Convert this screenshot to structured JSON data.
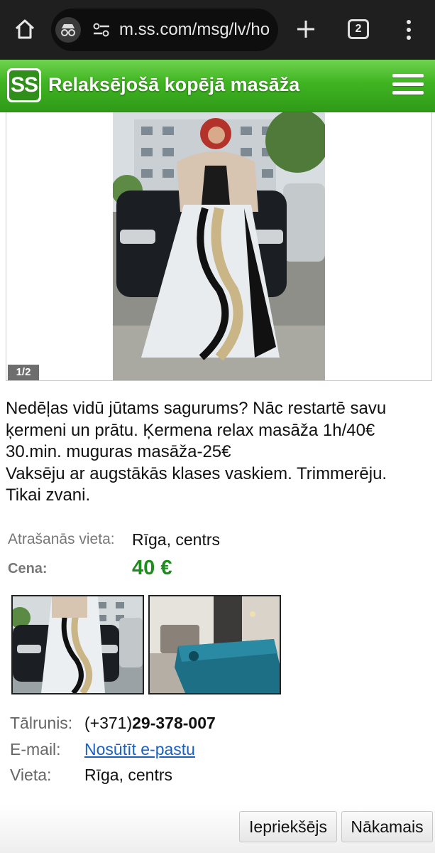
{
  "browser": {
    "url": "m.ss.com/msg/lv/ho",
    "tab_count": "2",
    "icons": [
      "home-icon",
      "incognito-icon",
      "site-settings-icon",
      "plus-icon",
      "tab-switcher-icon",
      "more-vert-icon"
    ]
  },
  "header": {
    "logo": "SS",
    "title": "Relaksējošā kopējā masāža",
    "menu_icon": "hamburger-icon",
    "colors": {
      "header_green": "#3fb421",
      "logo_green": "#2f8f1a"
    }
  },
  "photo": {
    "counter": "1/2"
  },
  "description": {
    "lines": [
      "Nedēļas vidū jūtams sagurums? Nāc restartē savu",
      "ķermeni un prātu. Ķermena relax masāža 1h/40€",
      "30.min. muguras masāža-25€",
      "Vaksēju ar augstākās klases vaskiem. Trimmerēju.",
      "Tikai zvani."
    ]
  },
  "details": {
    "location_label": "Atrašanās vieta:",
    "location_value": "Rīga, centrs",
    "price_label": "Cena:",
    "price_value": "40 €",
    "price_color": "#1e8d1e"
  },
  "contacts": {
    "phone_label": "Tālrunis:",
    "phone_prefix": "(+371)",
    "phone_number": "29-378-007",
    "email_label": "E-mail:",
    "email_link": "Nosūtīt e-pastu",
    "place_label": "Vieta:",
    "place_value": "Rīga, centrs"
  },
  "navigation": {
    "prev_label": "Iepriekšējs",
    "next_label": "Nākamais"
  }
}
